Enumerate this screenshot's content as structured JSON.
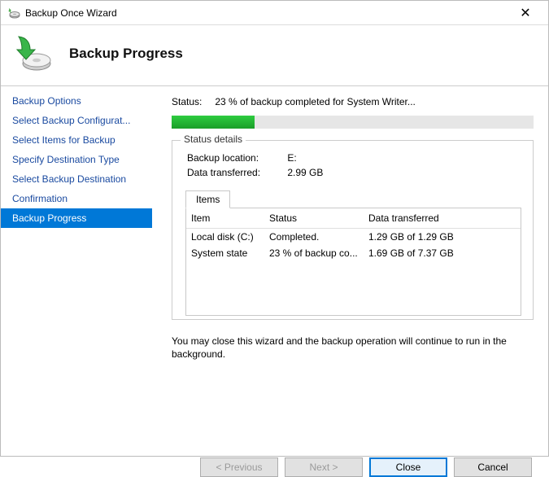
{
  "window": {
    "title": "Backup Once Wizard"
  },
  "header": {
    "title": "Backup Progress"
  },
  "sidebar": {
    "items": [
      {
        "label": "Backup Options"
      },
      {
        "label": "Select Backup Configurat..."
      },
      {
        "label": "Select Items for Backup"
      },
      {
        "label": "Specify Destination Type"
      },
      {
        "label": "Select Backup Destination"
      },
      {
        "label": "Confirmation"
      },
      {
        "label": "Backup Progress"
      }
    ],
    "active_index": 6
  },
  "status": {
    "label": "Status:",
    "text": "23 % of backup completed for System Writer...",
    "progress_percent": 23
  },
  "details": {
    "legend": "Status details",
    "location_label": "Backup location:",
    "location_value": "E:",
    "transferred_label": "Data transferred:",
    "transferred_value": "2.99 GB",
    "tab_label": "Items",
    "columns": {
      "item": "Item",
      "status": "Status",
      "xfer": "Data transferred"
    },
    "rows": [
      {
        "item": "Local disk (C:)",
        "status": "Completed.",
        "xfer": "1.29 GB of 1.29 GB"
      },
      {
        "item": "System state",
        "status": "23 % of backup co...",
        "xfer": "1.69 GB of 7.37 GB"
      }
    ]
  },
  "note": "You may close this wizard and the backup operation will continue to run in the background.",
  "buttons": {
    "previous": "< Previous",
    "next": "Next >",
    "close": "Close",
    "cancel": "Cancel"
  }
}
